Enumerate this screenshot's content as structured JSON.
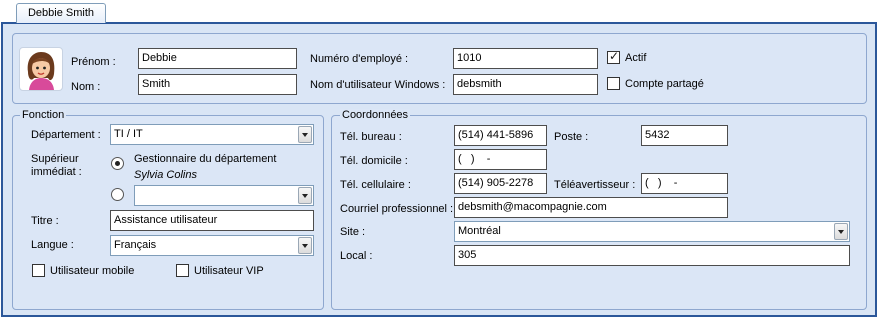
{
  "tab": {
    "label": "Debbie Smith"
  },
  "identity": {
    "prenom_label": "Prénom :",
    "prenom_value": "Debbie",
    "nom_label": "Nom :",
    "nom_value": "Smith",
    "employee_number_label": "Numéro d'employé :",
    "employee_number_value": "1010",
    "windows_user_label": "Nom d'utilisateur Windows :",
    "windows_user_value": "debsmith",
    "actif_label": "Actif",
    "actif_checked": true,
    "shared_account_label": "Compte partagé",
    "shared_account_checked": false
  },
  "fonction": {
    "legend": "Fonction",
    "department_label": "Département :",
    "department_value": "TI / IT",
    "superior_label_line1": "Supérieur",
    "superior_label_line2": "immédiat :",
    "superior_option1_label": "Gestionnaire du département",
    "superior_option1_name": "Sylvia Colins",
    "superior_option2_value": "",
    "title_label": "Titre :",
    "title_value": "Assistance utilisateur",
    "language_label": "Langue :",
    "language_value": "Français",
    "mobile_user_label": "Utilisateur mobile",
    "vip_user_label": "Utilisateur VIP"
  },
  "coordonnees": {
    "legend": "Coordonnées",
    "office_phone_label": "Tél. bureau :",
    "office_phone_value": "(514) 441-5896",
    "extension_label": "Poste :",
    "extension_value": "5432",
    "home_phone_label": "Tél. domicile :",
    "home_phone_value": "(   )    -",
    "cell_phone_label": "Tél. cellulaire :",
    "cell_phone_value": "(514) 905-2278",
    "pager_label": "Téléavertisseur :",
    "pager_value": "(   )    -",
    "email_label": "Courriel professionnel :",
    "email_value": "debsmith@macompagnie.com",
    "site_label": "Site :",
    "site_value": "Montréal",
    "local_label": "Local :",
    "local_value": "305"
  }
}
